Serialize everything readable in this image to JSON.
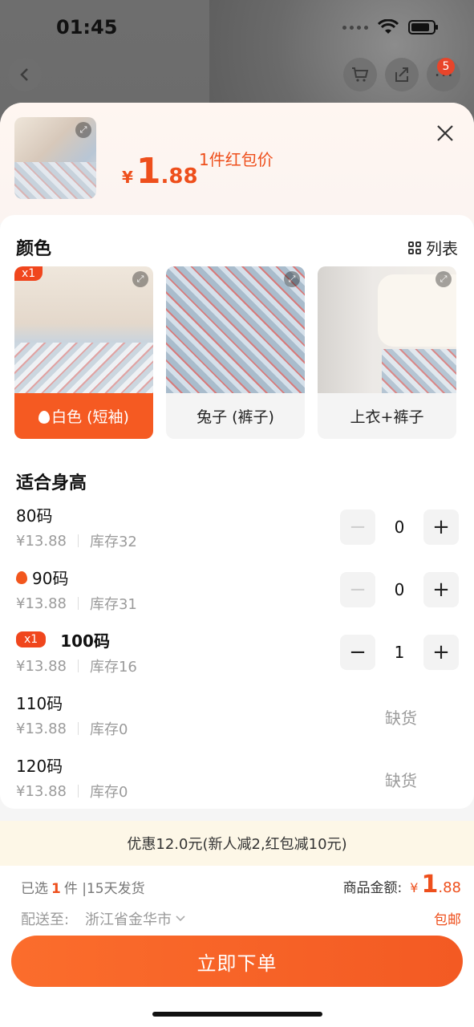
{
  "status_bar": {
    "time": "01:45"
  },
  "nav": {
    "cart_badge": "5"
  },
  "sheet": {
    "price": {
      "yen": "¥",
      "int": "1",
      "dec": ".88"
    },
    "price_note": "1件红包价"
  },
  "color_section": {
    "title": "颜色",
    "list_toggle": "列表",
    "options": [
      {
        "label": "白色 (短袖)",
        "tag": "x1",
        "selected": true
      },
      {
        "label": "兔子 (裤子)"
      },
      {
        "label": "上衣+裤子"
      }
    ]
  },
  "size_section": {
    "title": "适合身高",
    "out_of_stock": "缺货",
    "rows": [
      {
        "name": "80码",
        "price": "¥13.88",
        "stock": "库存32",
        "qty": "0"
      },
      {
        "name": "90码",
        "price": "¥13.88",
        "stock": "库存31",
        "qty": "0"
      },
      {
        "name": "100码",
        "tag": "x1",
        "price": "¥13.88",
        "stock": "库存16",
        "qty": "1"
      },
      {
        "name": "110码",
        "price": "¥13.88",
        "stock": "库存0"
      },
      {
        "name": "120码",
        "price": "¥13.88",
        "stock": "库存0"
      }
    ]
  },
  "promo": "优惠12.0元(新人减2,红包减10元)",
  "summary": {
    "selected_prefix": "已选",
    "selected_count": "1",
    "selected_suffix": "件 |15天发货",
    "amount_label": "商品金额:",
    "amount_yen": "¥",
    "amount_int": "1",
    "amount_dec": ".88",
    "ship_label": "配送至:",
    "ship_city": "浙江省金华市",
    "free_shipping": "包邮"
  },
  "order_button": "立即下单",
  "colors": {
    "accent": "#f35a23",
    "promo_bg": "#fdf7e7"
  }
}
